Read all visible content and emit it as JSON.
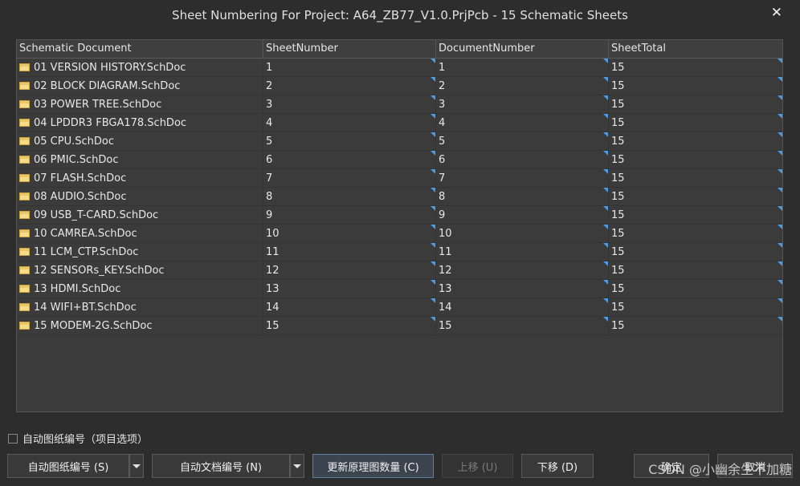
{
  "window": {
    "title": "Sheet Numbering For Project: A64_ZB77_V1.0.PrjPcb  - 15 Schematic Sheets",
    "close_symbol": "✕"
  },
  "grid": {
    "columns": [
      "Schematic Document",
      "SheetNumber",
      "DocumentNumber",
      "SheetTotal"
    ],
    "rows": [
      {
        "doc": "01 VERSION HISTORY.SchDoc",
        "sheet": "1",
        "docnum": "1",
        "total": "15"
      },
      {
        "doc": "02 BLOCK DIAGRAM.SchDoc",
        "sheet": "2",
        "docnum": "2",
        "total": "15"
      },
      {
        "doc": "03 POWER TREE.SchDoc",
        "sheet": "3",
        "docnum": "3",
        "total": "15"
      },
      {
        "doc": "04 LPDDR3 FBGA178.SchDoc",
        "sheet": "4",
        "docnum": "4",
        "total": "15"
      },
      {
        "doc": "05 CPU.SchDoc",
        "sheet": "5",
        "docnum": "5",
        "total": "15"
      },
      {
        "doc": "06 PMIC.SchDoc",
        "sheet": "6",
        "docnum": "6",
        "total": "15"
      },
      {
        "doc": "07 FLASH.SchDoc",
        "sheet": "7",
        "docnum": "7",
        "total": "15"
      },
      {
        "doc": "08 AUDIO.SchDoc",
        "sheet": "8",
        "docnum": "8",
        "total": "15"
      },
      {
        "doc": "09 USB_T-CARD.SchDoc",
        "sheet": "9",
        "docnum": "9",
        "total": "15"
      },
      {
        "doc": "10 CAMREA.SchDoc",
        "sheet": "10",
        "docnum": "10",
        "total": "15"
      },
      {
        "doc": "11 LCM_CTP.SchDoc",
        "sheet": "11",
        "docnum": "11",
        "total": "15"
      },
      {
        "doc": "12 SENSORs_KEY.SchDoc",
        "sheet": "12",
        "docnum": "12",
        "total": "15"
      },
      {
        "doc": "13 HDMI.SchDoc",
        "sheet": "13",
        "docnum": "13",
        "total": "15"
      },
      {
        "doc": "14 WIFI+BT.SchDoc",
        "sheet": "14",
        "docnum": "14",
        "total": "15"
      },
      {
        "doc": "15 MODEM-2G.SchDoc",
        "sheet": "15",
        "docnum": "15",
        "total": "15"
      }
    ]
  },
  "options": {
    "auto_sheet_checkbox_label": "自动图纸编号（项目选项）",
    "auto_sheet_checked": false
  },
  "buttons": {
    "auto_sheet_number": "自动图纸编号 (S)",
    "auto_doc_number": "自动文档编号 (N)",
    "update_sheet_count": "更新原理图数量 (C)",
    "move_up": "上移 (U)",
    "move_down": "下移 (D)",
    "ok": "确定",
    "cancel": "取消"
  },
  "watermark": "CSDN @小幽余生不加糖",
  "colors": {
    "background": "#2d2d2d",
    "grid_background": "#3b3b3b",
    "edit_marker": "#4b9ce8",
    "doc_icon": "#f3dc8c"
  },
  "icons": {
    "document": "schdoc-icon",
    "close": "close-icon"
  }
}
